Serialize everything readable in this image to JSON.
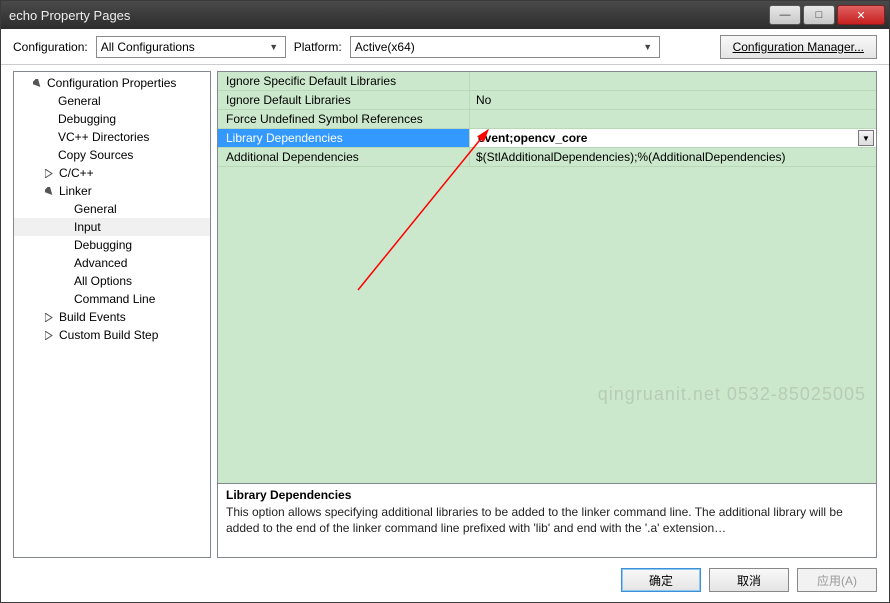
{
  "title": "echo Property Pages",
  "configRow": {
    "configLabel": "Configuration:",
    "configValue": "All Configurations",
    "platformLabel": "Platform:",
    "platformValue": "Active(x64)",
    "managerBtn": "Configuration Manager..."
  },
  "tree": {
    "root": "Configuration Properties",
    "items": [
      "General",
      "Debugging",
      "VC++ Directories",
      "Copy Sources"
    ],
    "ccpp": "C/C++",
    "linker": "Linker",
    "linkerItems": [
      "General",
      "Input",
      "Debugging",
      "Advanced",
      "All Options",
      "Command Line"
    ],
    "buildEvents": "Build Events",
    "customBuild": "Custom Build Step"
  },
  "grid": {
    "rows": [
      {
        "label": "Ignore Specific Default Libraries",
        "value": ""
      },
      {
        "label": "Ignore Default Libraries",
        "value": "No"
      },
      {
        "label": "Force Undefined Symbol References",
        "value": ""
      }
    ],
    "selected": {
      "label": "Library Dependencies",
      "value": "event;opencv_core"
    },
    "last": {
      "label": "Additional Dependencies",
      "value": "$(StlAdditionalDependencies);%(AdditionalDependencies)"
    }
  },
  "desc": {
    "title": "Library Dependencies",
    "text": "This option allows specifying additional libraries to be  added to the linker command line. The additional library will be added to the end of the linker command line  prefixed with 'lib' and end with the '.a' extension…"
  },
  "footer": {
    "ok": "确定",
    "cancel": "取消",
    "apply": "应用(A)"
  },
  "watermark": "qingruanit.net 0532-85025005"
}
